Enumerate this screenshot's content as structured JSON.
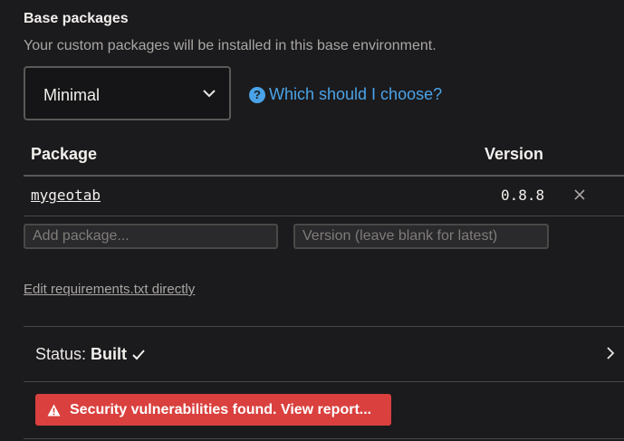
{
  "base_packages": {
    "title": "Base packages",
    "description": "Your custom packages will be installed in this base environment.",
    "select": {
      "value": "Minimal",
      "icon": "chevron-down-icon"
    },
    "help_link": {
      "icon_glyph": "?",
      "label": "Which should I choose?"
    }
  },
  "table": {
    "headers": {
      "package": "Package",
      "version": "Version"
    },
    "rows": [
      {
        "name": "mygeotab",
        "version": "0.8.8",
        "remove_icon": "close-icon"
      }
    ],
    "add_package_placeholder": "Add package...",
    "add_version_placeholder": "Version (leave blank for latest)"
  },
  "edit_requirements_label": "Edit requirements.txt directly",
  "status": {
    "label": "Status:",
    "value": "Built",
    "icon": "check-icon",
    "chevron": "chevron-right-icon"
  },
  "alert": {
    "icon": "warning-icon",
    "text": "Security vulnerabilities found. View report...",
    "color": "#d9403e"
  },
  "colors": {
    "background": "#1b1a1c",
    "accent": "#4aa3e8"
  }
}
